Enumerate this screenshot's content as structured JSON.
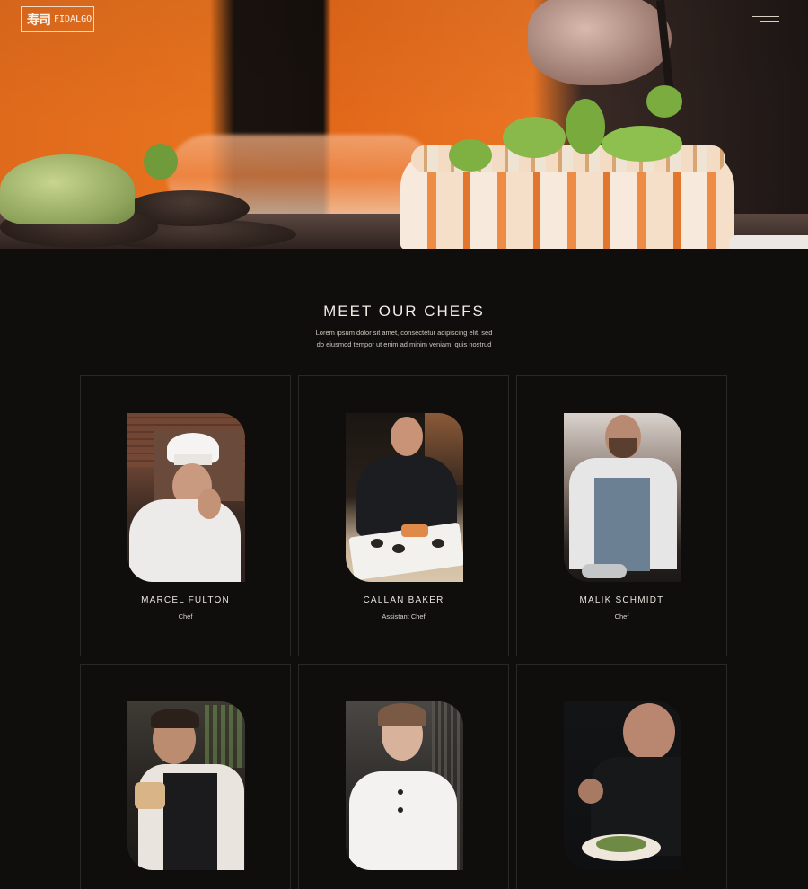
{
  "header": {
    "logo_kanji": "寿司",
    "logo_text": "FIDALGO",
    "menu_icon": "hamburger-menu-icon"
  },
  "hero": {
    "image": "sushi-roll-with-microgreens"
  },
  "section": {
    "title": "MEET OUR CHEFS",
    "description_line1": "Lorem ipsum dolor sit amet, consectetur adipiscing elit, sed",
    "description_line2": "do eiusmod tempor ut enim ad minim veniam, quis nostrud"
  },
  "chefs": [
    {
      "name": "MARCEL FULTON",
      "role": "Chef"
    },
    {
      "name": "CALLAN BAKER",
      "role": "Assistant Chef"
    },
    {
      "name": "MALIK SCHMIDT",
      "role": "Chef"
    },
    {
      "name": "",
      "role": ""
    },
    {
      "name": "",
      "role": ""
    },
    {
      "name": "",
      "role": ""
    }
  ],
  "colors": {
    "background": "#0f0e0d",
    "card_border": "#2a2826",
    "accent_orange": "#e7721e",
    "text_light": "#f1ece5"
  }
}
